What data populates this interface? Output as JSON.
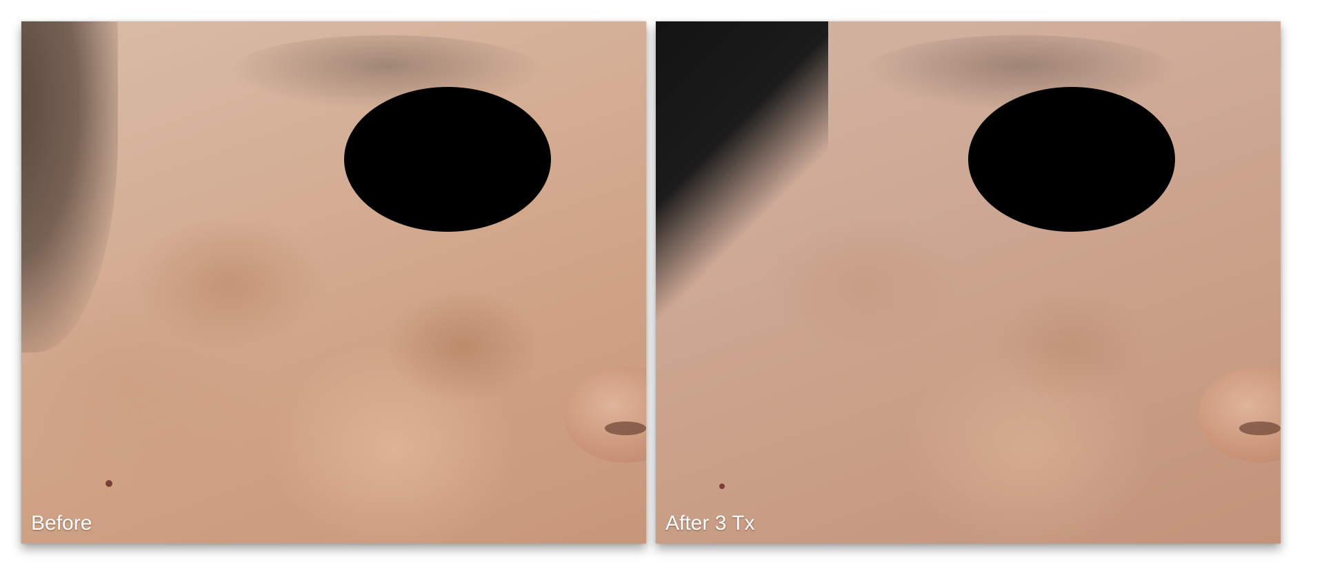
{
  "panels": [
    {
      "id": "before",
      "caption": "Before"
    },
    {
      "id": "after",
      "caption": "After 3 Tx"
    }
  ],
  "colors": {
    "background": "#ffffff",
    "eye_mask": "#000000",
    "caption_text": "#ffffff"
  }
}
